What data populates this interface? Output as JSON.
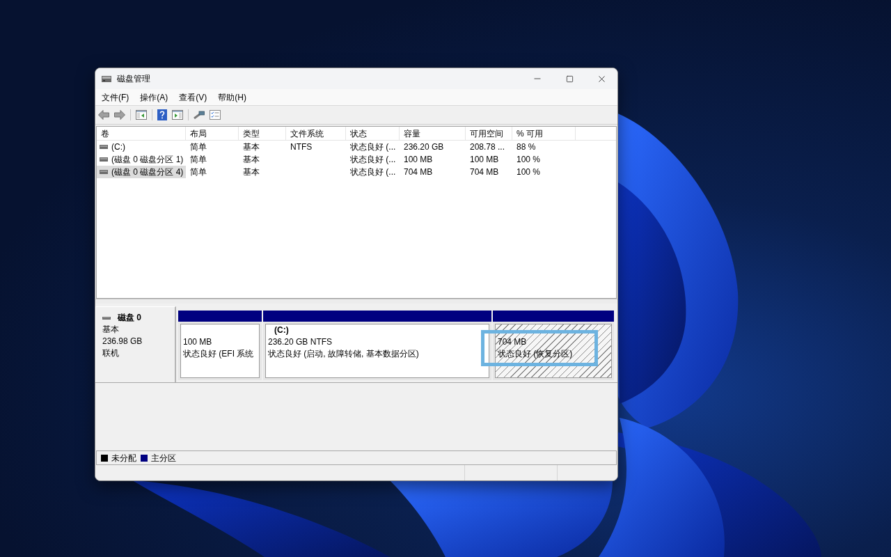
{
  "window": {
    "title": "磁盘管理"
  },
  "menu": [
    "文件(F)",
    "操作(A)",
    "查看(V)",
    "帮助(H)"
  ],
  "volume_table": {
    "columns": [
      "卷",
      "布局",
      "类型",
      "文件系统",
      "状态",
      "容量",
      "可用空间",
      "% 可用"
    ],
    "rows": [
      {
        "volume": "(C:)",
        "layout": "简单",
        "type": "基本",
        "file_system": "NTFS",
        "status": "状态良好 (...",
        "capacity": "236.20 GB",
        "free_space": "208.78 ...",
        "percent_free": "88 %",
        "selected": false
      },
      {
        "volume": "(磁盘 0 磁盘分区 1)",
        "layout": "简单",
        "type": "基本",
        "status": "状态良好 (...",
        "capacity": "100 MB",
        "free_space": "100 MB",
        "percent_free": "100 %",
        "selected": false
      },
      {
        "volume": "(磁盘 0 磁盘分区 4)",
        "layout": "简单",
        "type": "基本",
        "status": "状态良好 (...",
        "capacity": "704 MB",
        "free_space": "704 MB",
        "percent_free": "100 %",
        "selected": true
      }
    ]
  },
  "disks": [
    {
      "name": "磁盘 0",
      "type": "基本",
      "size": "236.98 GB",
      "status": "联机",
      "partitions": [
        {
          "kind": "primary",
          "size": "100 MB",
          "status": "状态良好 (EFI 系统",
          "selected": false
        },
        {
          "kind": "primary",
          "label": "(C:)",
          "size": "236.20 GB NTFS",
          "status": "状态良好 (启动, 故障转储, 基本数据分区)",
          "selected": false
        },
        {
          "kind": "primary",
          "size": "704 MB",
          "status": "状态良好 (恢复分区)",
          "selected": true
        }
      ]
    }
  ],
  "legend": [
    {
      "kind": "unallocated",
      "label": "未分配",
      "color": "#000000"
    },
    {
      "kind": "primary",
      "label": "主分区",
      "color": "#000080"
    }
  ]
}
